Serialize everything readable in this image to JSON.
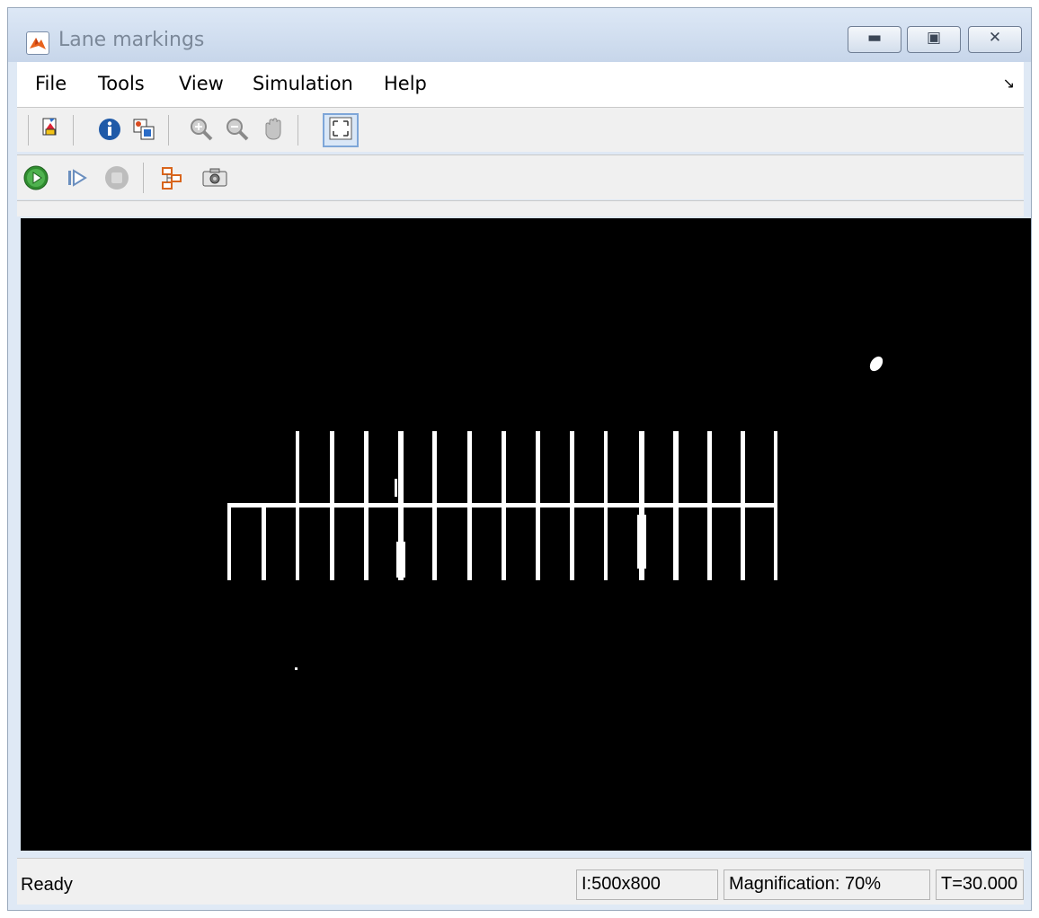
{
  "window": {
    "title": "Lane markings",
    "buttons": [
      "minimize",
      "restore",
      "close"
    ]
  },
  "menu": {
    "items": [
      "File",
      "Tools",
      "View",
      "Simulation",
      "Help"
    ]
  },
  "toolbar1": {
    "icons": [
      "print-icon",
      "info-icon",
      "copy-image-icon",
      "zoom-in-icon",
      "zoom-out-icon",
      "pan-hand-icon",
      "fit-to-view-icon"
    ]
  },
  "toolbar2": {
    "icons": [
      "run-icon",
      "step-forward-icon",
      "stop-icon",
      "highlight-model-icon",
      "snapshot-icon"
    ]
  },
  "status": {
    "text": "Ready",
    "dimensions": "I:500x800",
    "magnification": "Magnification: 70%",
    "time": "T=30.000"
  }
}
